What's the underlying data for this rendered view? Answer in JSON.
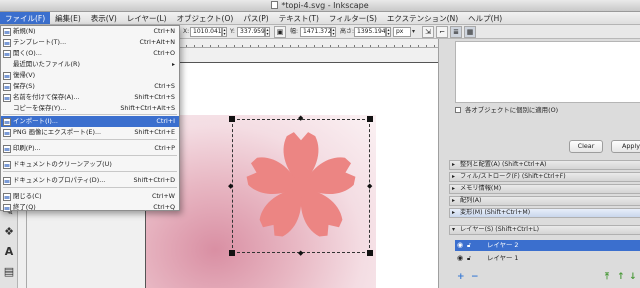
{
  "window": {
    "title": "*topi-4.svg - Inkscape"
  },
  "menubar": [
    "ファイル(F)",
    "編集(E)",
    "表示(V)",
    "レイヤー(L)",
    "オブジェクト(O)",
    "パス(P)",
    "テキスト(T)",
    "フィルター(S)",
    "エクステンション(N)",
    "ヘルプ(H)"
  ],
  "toolbar": {
    "x_label": "X:",
    "x_value": "1010.041",
    "y_label": "Y:",
    "y_value": "337.959",
    "w_label": "幅:",
    "w_value": "1471.372",
    "h_label": "高さ:",
    "h_value": "1395.194",
    "unit": "px"
  },
  "file_menu": [
    {
      "label": "新規(N)",
      "shortcut": "Ctrl+N",
      "icon": "new-file-icon"
    },
    {
      "label": "テンプレート(T)...",
      "shortcut": "Ctrl+Alt+N",
      "icon": "template-icon"
    },
    {
      "label": "開く(O)...",
      "shortcut": "Ctrl+O",
      "icon": "open-folder-icon"
    },
    {
      "label": "最近開いたファイル(R)",
      "shortcut": "",
      "submenu": true,
      "icon": ""
    },
    {
      "label": "復帰(V)",
      "shortcut": "",
      "icon": "revert-icon"
    },
    {
      "label": "保存(S)",
      "shortcut": "Ctrl+S",
      "icon": "save-icon"
    },
    {
      "label": "名前を付けて保存(A)...",
      "shortcut": "Shift+Ctrl+S",
      "icon": "save-as-icon"
    },
    {
      "label": "コピーを保存(Y)...",
      "shortcut": "Shift+Ctrl+Alt+S",
      "icon": ""
    },
    {
      "label": "インポート(I)...",
      "shortcut": "Ctrl+I",
      "icon": "import-icon",
      "highlighted": true
    },
    {
      "label": "PNG 画像にエクスポート(E)...",
      "shortcut": "Shift+Ctrl+E",
      "icon": "export-png-icon"
    },
    {
      "label": "印刷(P)...",
      "shortcut": "Ctrl+P",
      "icon": "print-icon"
    },
    {
      "label": "ドキュメントのクリーンアップ(U)",
      "shortcut": "",
      "icon": "cleanup-icon"
    },
    {
      "label": "ドキュメントのプロパティ(D)...",
      "shortcut": "Shift+Ctrl+D",
      "icon": "document-properties-icon"
    },
    {
      "label": "閉じる(C)",
      "shortcut": "Ctrl+W",
      "icon": "close-icon"
    },
    {
      "label": "終了(Q)",
      "shortcut": "Ctrl+Q",
      "icon": "quit-icon"
    }
  ],
  "right_panel": {
    "apply_each_label": "各オブジェクトに個別に適用(O)",
    "clear_label": "Clear",
    "apply_label": "Apply",
    "docks": [
      "整列と配置(A) (Shift+Ctrl+A)",
      "フィル/ストローク(F) (Shift+Ctrl+F)",
      "メモリ情報(M)",
      "配列(A)",
      "変形(M) (Shift+Ctrl+M)",
      "レイヤー(S) (Shift+Ctrl+L)"
    ],
    "layers": [
      "レイヤー 2",
      "レイヤー 1"
    ]
  },
  "colors": {
    "highlight": "#3b6fce",
    "petal": "#ec8583",
    "background_gradient": "#d98fa3"
  }
}
